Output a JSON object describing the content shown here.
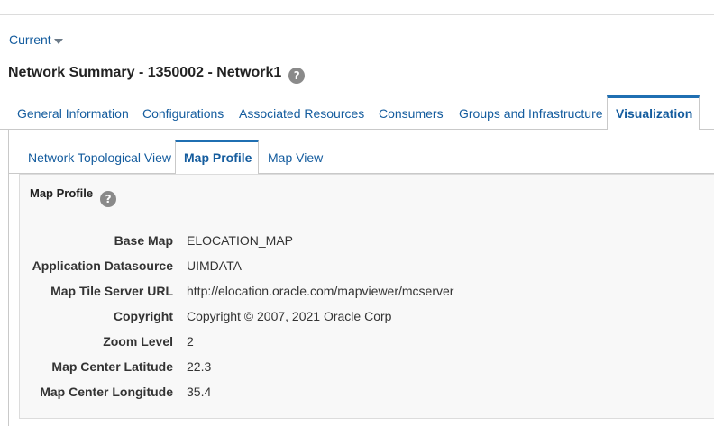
{
  "header": {
    "current_label": "Current",
    "page_title": "Network Summary - 1350002 - Network1",
    "help_glyph": "?"
  },
  "main_tabs": [
    {
      "label": "General Information",
      "active": false
    },
    {
      "label": "Configurations",
      "active": false
    },
    {
      "label": "Associated Resources",
      "active": false
    },
    {
      "label": "Consumers",
      "active": false
    },
    {
      "label": "Groups and Infrastructure",
      "active": false
    },
    {
      "label": "Visualization",
      "active": true
    }
  ],
  "sub_tabs": [
    {
      "label": "Network Topological View",
      "active": false
    },
    {
      "label": "Map Profile",
      "active": true
    },
    {
      "label": "Map View",
      "active": false
    }
  ],
  "map_profile": {
    "title": "Map Profile",
    "fields": [
      {
        "label": "Base Map",
        "value": "ELOCATION_MAP"
      },
      {
        "label": "Application Datasource",
        "value": "UIMDATA"
      },
      {
        "label": "Map Tile Server URL",
        "value": "http://elocation.oracle.com/mapviewer/mcserver"
      },
      {
        "label": "Copyright",
        "value": "Copyright © 2007, 2021 Oracle Corp"
      },
      {
        "label": "Zoom Level",
        "value": "2"
      },
      {
        "label": "Map Center Latitude",
        "value": "22.3"
      },
      {
        "label": "Map Center Longitude",
        "value": "35.4"
      }
    ]
  },
  "colors": {
    "link": "#145c9e",
    "active_tab_accent": "#1f6fb2",
    "help_icon_bg": "#8a8a8a"
  }
}
